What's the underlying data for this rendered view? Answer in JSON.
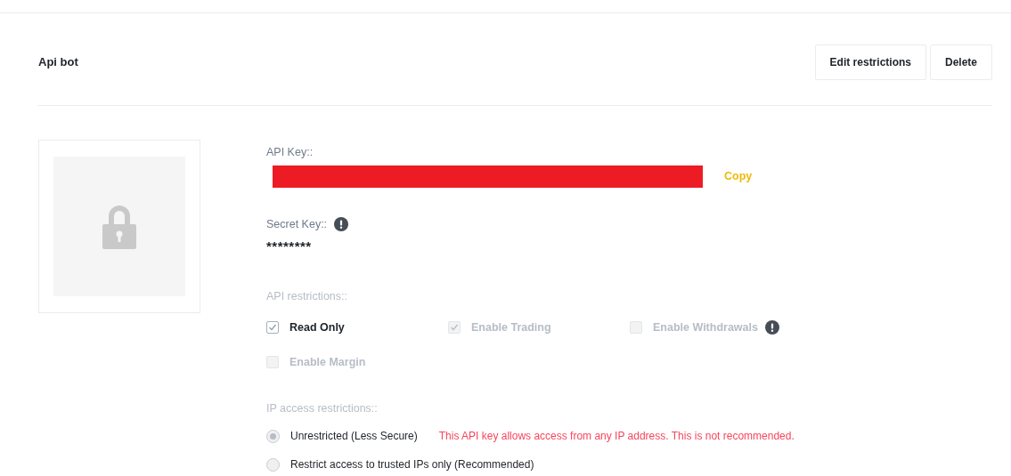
{
  "header": {
    "title": "Api bot",
    "buttons": [
      "Edit restrictions",
      "Delete"
    ]
  },
  "api_key": {
    "label": "API Key::",
    "redacted": true,
    "copy_label": "Copy"
  },
  "secret_key": {
    "label": "Secret Key::",
    "info": true,
    "value": "********"
  },
  "api_restrictions": {
    "label": "API restrictions::",
    "options": [
      {
        "label": "Read Only",
        "checked": true,
        "disabled": false,
        "info": false
      },
      {
        "label": "Enable Trading",
        "checked": true,
        "disabled": true,
        "info": false
      },
      {
        "label": "Enable Withdrawals",
        "checked": false,
        "disabled": true,
        "info": true
      },
      {
        "label": "Enable Margin",
        "checked": false,
        "disabled": true,
        "info": false
      }
    ]
  },
  "ip_restrictions": {
    "label": "IP access restrictions::",
    "options": [
      {
        "label": "Unrestricted (Less Secure)",
        "selected": true,
        "warning": "This API key allows access from any IP address. This is not recommended."
      },
      {
        "label": "Restrict access to trusted IPs only (Recommended)",
        "selected": false
      }
    ]
  }
}
